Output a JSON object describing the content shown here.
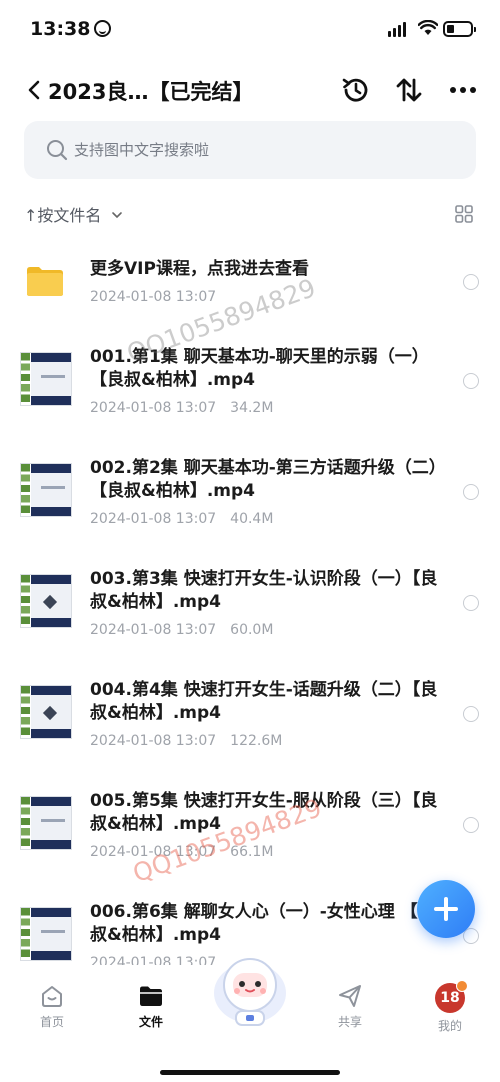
{
  "status_bar": {
    "time": "13:38"
  },
  "header": {
    "title": "2023良…【已完结】"
  },
  "search": {
    "placeholder": "支持图中文字搜索啦"
  },
  "sort": {
    "label": "↑按文件名"
  },
  "folder": {
    "name": "更多VIP课程，点我进去查看",
    "date": "2024-01-08 13:07"
  },
  "files": [
    {
      "name": "001.第1集 聊天基本功-聊天里的示弱（一）【良叔&柏林】.mp4",
      "date": "2024-01-08 13:07",
      "size": "34.2M"
    },
    {
      "name": "002.第2集 聊天基本功-第三方话题升级（二）【良叔&柏林】.mp4",
      "date": "2024-01-08 13:07",
      "size": "40.4M"
    },
    {
      "name": "003.第3集 快速打开女生-认识阶段（一）【良叔&柏林】.mp4",
      "date": "2024-01-08 13:07",
      "size": "60.0M"
    },
    {
      "name": "004.第4集 快速打开女生-话题升级（二）【良叔&柏林】.mp4",
      "date": "2024-01-08 13:07",
      "size": "122.6M"
    },
    {
      "name": "005.第5集 快速打开女生-服从阶段（三）【良叔&柏林】.mp4",
      "date": "2024-01-08 13:07",
      "size": "66.1M"
    },
    {
      "name": "006.第6集 解聊女人心（一）-女性心理 【良叔&柏林】.mp4",
      "date": "2024-01-08 13:07",
      "size": ""
    }
  ],
  "watermarks": {
    "gray": "QQ1055894829",
    "red": "QQ1055894829"
  },
  "bottom_nav": {
    "home": "首页",
    "files": "文件",
    "share": "共享",
    "mine": "我的",
    "mine_badge": "18"
  },
  "colors": {
    "accent": "#2f7df6",
    "folder": "#f7c948",
    "badge": "#c8372d"
  }
}
